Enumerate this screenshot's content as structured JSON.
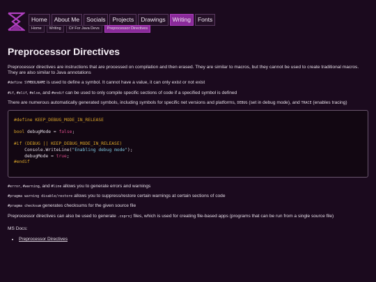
{
  "nav": {
    "items": [
      "Home",
      "About Me",
      "Socials",
      "Projects",
      "Drawings",
      "Writing",
      "Fonts"
    ],
    "active_index": 5
  },
  "breadcrumbs": {
    "items": [
      "Home",
      "Writing",
      "C# For Java Devs",
      "Preprocessor Directives"
    ],
    "active_index": 3
  },
  "page": {
    "title": "Preprocessor Directives",
    "intro": "Preprocessor directives are instructions that are processed on compilation and then erased. They are similar to macros, but they cannot be used to create traditional macros. They are also similar to Java annotations",
    "p_define": {
      "code": "#define SYMBOLNAME",
      "text": " is used to define a symbol. It cannot have a value, it can only exist or not exist"
    },
    "p_if": {
      "code1": "#if",
      "sep1": ", ",
      "code2": "#elif",
      "sep2": ", ",
      "code3": "#else",
      "sep3": ", and ",
      "code4": "#endif",
      "text": " can be used to only compile specific sections of code if a specified symbol is defined"
    },
    "p_auto": {
      "text1": "There are numerous automatically generated symbols, including symbols for specific net versions and platforms, ",
      "code1": "DEBUG",
      "text2": " (set in debug mode), and ",
      "code2": "TRACE",
      "text3": " (enables tracing)"
    },
    "p_error": {
      "code1": "#error",
      "sep1": ", ",
      "code2": "#warning",
      "sep2": ", and ",
      "code3": "#line",
      "text": " allows you to generate errors and warnings"
    },
    "p_pragma_warning": {
      "code": "#pragma warning disable/restore",
      "text": " allows you to suppress/restore certain warnings at certain sections of code"
    },
    "p_pragma_checksum": {
      "code": "#pragma checksum",
      "text": " generates checksums for the given source file"
    },
    "p_csproj": {
      "text1": "Preprocessor directives can also be used to generate ",
      "code": ".csproj",
      "text2": " files, which is used for creating file-based apps (programs that can be run from a single source file)"
    },
    "ms_docs_label": "MS Docs:",
    "ms_docs_link": "Preprocessor Directives"
  },
  "code_block": {
    "lines": [
      {
        "tokens": [
          [
            "directive",
            "#define KEEP_DEBUG_MODE_IN_RELEASE"
          ]
        ]
      },
      {
        "tokens": []
      },
      {
        "tokens": [
          [
            "type",
            "bool"
          ],
          [
            "plain",
            " debugMode = "
          ],
          [
            "kw",
            "false"
          ],
          [
            "plain",
            ";"
          ]
        ]
      },
      {
        "tokens": []
      },
      {
        "tokens": [
          [
            "directive",
            "#if (DEBUG || KEEP_DEBUG_MODE_IN_RELEASE)"
          ]
        ]
      },
      {
        "tokens": [
          [
            "plain",
            "    Console.WriteLine("
          ],
          [
            "str",
            "\"Enabling debug mode\""
          ],
          [
            "plain",
            ");"
          ]
        ]
      },
      {
        "tokens": [
          [
            "plain",
            "    debugMode = "
          ],
          [
            "kw",
            "true"
          ],
          [
            "plain",
            ";"
          ]
        ]
      },
      {
        "tokens": [
          [
            "directive",
            "#endif"
          ]
        ]
      }
    ]
  },
  "colors": {
    "background": "#1b0a1e",
    "accent": "#8a2a9a",
    "code_directive": "#d9a428",
    "code_keyword": "#d94b8a",
    "code_string": "#7fc8e0"
  },
  "icons": {
    "logo": "hourglass-logo-icon"
  }
}
